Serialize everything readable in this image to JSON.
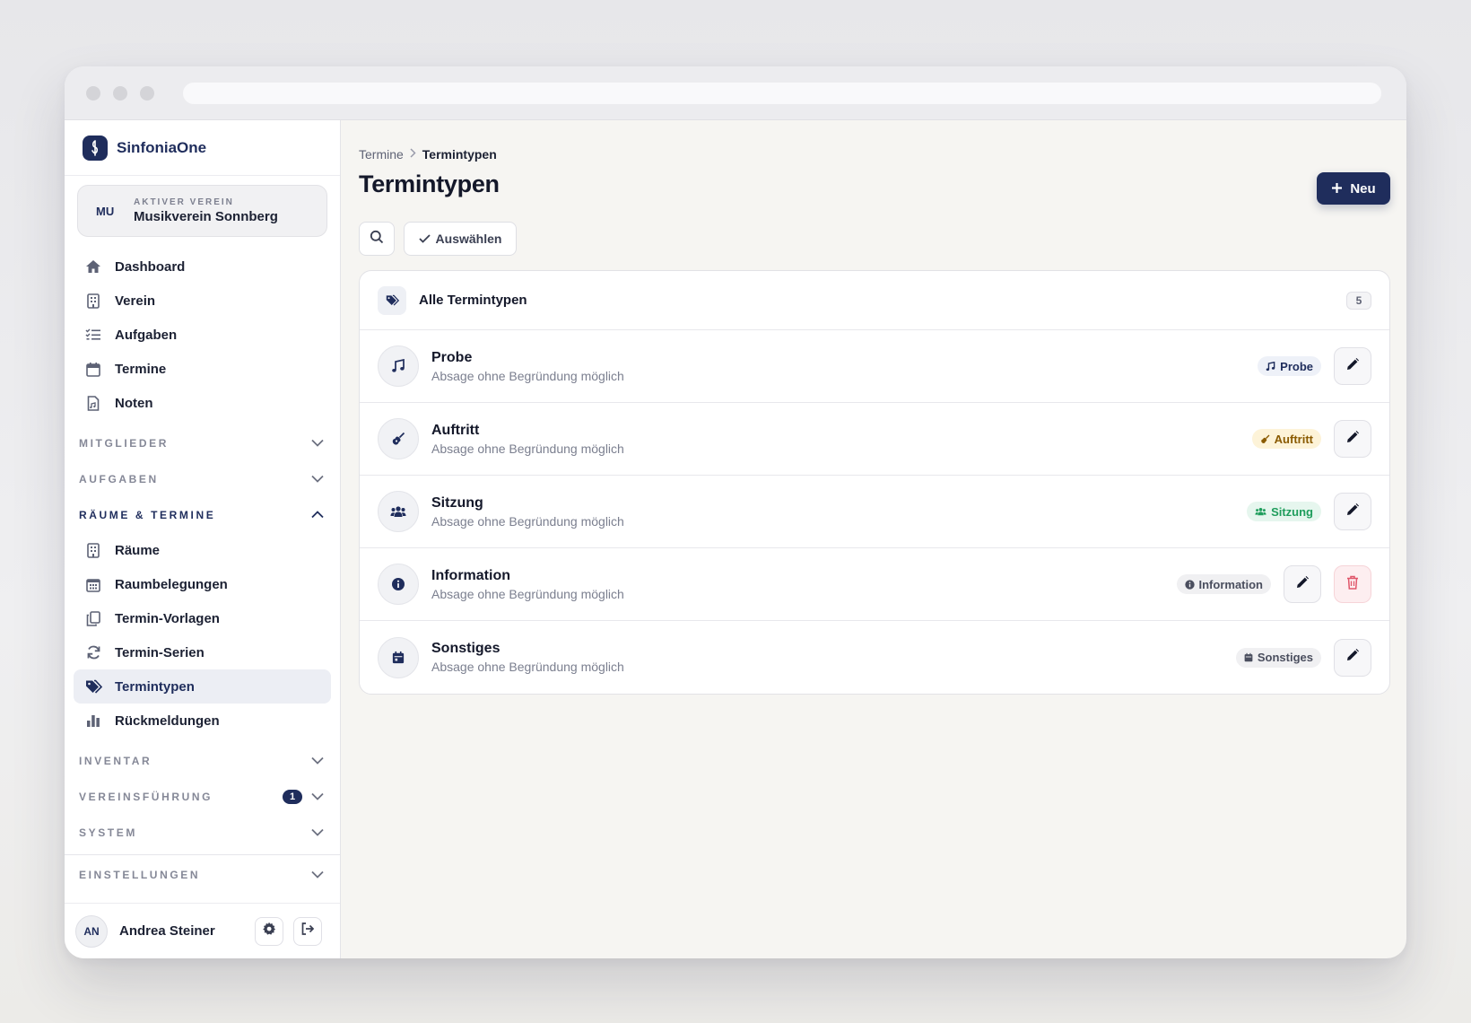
{
  "app": {
    "name": "SinfoniaOne"
  },
  "verein": {
    "abbr": "MU",
    "label": "AKTIVER VEREIN",
    "name": "Musikverein Sonnberg"
  },
  "nav_main": [
    {
      "label": "Dashboard",
      "icon": "home-icon"
    },
    {
      "label": "Verein",
      "icon": "building-icon"
    },
    {
      "label": "Aufgaben",
      "icon": "list-icon"
    },
    {
      "label": "Termine",
      "icon": "calendar-icon"
    },
    {
      "label": "Noten",
      "icon": "document-icon"
    }
  ],
  "sections": {
    "mitglieder": "MITGLIEDER",
    "aufgaben": "AUFGABEN",
    "raeume_termine": "RÄUME & TERMINE",
    "inventar": "INVENTAR",
    "vereinsfuehrung": "VEREINSFÜHRUNG",
    "vereinsfuehrung_badge": "1",
    "system": "SYSTEM",
    "einstellungen": "EINSTELLUNGEN"
  },
  "nav_raeume": [
    {
      "label": "Räume",
      "icon": "building-icon"
    },
    {
      "label": "Raumbelegungen",
      "icon": "calendar-grid-icon"
    },
    {
      "label": "Termin-Vorlagen",
      "icon": "copy-icon"
    },
    {
      "label": "Termin-Serien",
      "icon": "refresh-icon"
    },
    {
      "label": "Termintypen",
      "icon": "tags-icon",
      "active": true
    },
    {
      "label": "Rückmeldungen",
      "icon": "bar-chart-icon"
    }
  ],
  "user": {
    "initials": "AN",
    "name": "Andrea Steiner"
  },
  "breadcrumb": {
    "parent": "Termine",
    "current": "Termintypen"
  },
  "page": {
    "title": "Termintypen",
    "new_label": "Neu",
    "select_label": "Auswählen"
  },
  "list": {
    "header": "Alle Termintypen",
    "count": "5",
    "rows": [
      {
        "title": "Probe",
        "subtitle": "Absage ohne Begründung möglich",
        "tag": "Probe",
        "icon": "music-note-icon",
        "tag_bg": "#eef1f8",
        "tag_fg": "#1f2d5c"
      },
      {
        "title": "Auftritt",
        "subtitle": "Absage ohne Begründung möglich",
        "tag": "Auftritt",
        "icon": "guitar-icon",
        "tag_bg": "#fdf3d8",
        "tag_fg": "#8a5a00"
      },
      {
        "title": "Sitzung",
        "subtitle": "Absage ohne Begründung möglich",
        "tag": "Sitzung",
        "icon": "users-icon",
        "tag_bg": "#e6f6ee",
        "tag_fg": "#1f9d5c"
      },
      {
        "title": "Information",
        "subtitle": "Absage ohne Begründung möglich",
        "tag": "Information",
        "icon": "info-icon",
        "tag_bg": "#f0f0f2",
        "tag_fg": "#4a4e5e"
      },
      {
        "title": "Sonstiges",
        "subtitle": "Absage ohne Begründung möglich",
        "tag": "Sonstiges",
        "icon": "calendar-icon",
        "tag_bg": "#f0f0f2",
        "tag_fg": "#4a4e5e"
      }
    ]
  },
  "colors": {
    "primary": "#1f2d5c",
    "danger": "#e0566a"
  }
}
